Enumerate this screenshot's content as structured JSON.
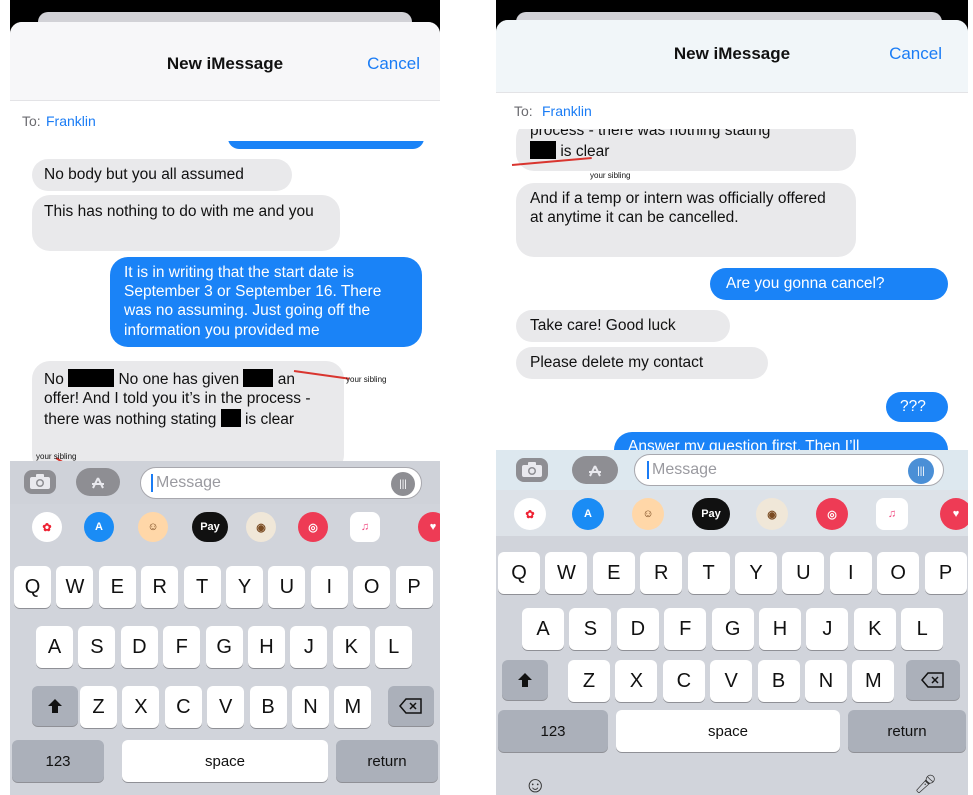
{
  "colors": {
    "accent": "#1a7cf5",
    "sent_bubble": "#1a83f7",
    "received_bubble": "#e9e9eb",
    "keyboard": "#d1d4db",
    "annotation": "#d9352f"
  },
  "left": {
    "nav": {
      "title": "New iMessage",
      "cancel": "Cancel"
    },
    "to": {
      "label": "To:",
      "name": "Franklin"
    },
    "messages": {
      "m1": "No body but you all assumed",
      "m2": "This has nothing to do with me and you",
      "m3": "It is in writing that the start date is September 3 or September 16. There was no assuming. Just going off the information you provided me",
      "m4a": "No",
      "m4b": "No one has given",
      "m4c": "an",
      "m4d": "offer! And I told you it’s in the process - there was nothing stating",
      "m4e": "is clear"
    },
    "notes": {
      "n1": "your sibling",
      "n2": "your sibling"
    },
    "input_placeholder": "Message"
  },
  "right": {
    "nav": {
      "title": "New iMessage",
      "cancel": "Cancel"
    },
    "to": {
      "label": "To:",
      "name": "Franklin"
    },
    "messages": {
      "m1a": "process - there was nothing stating",
      "m1b": "is clear",
      "m2": "And if a temp or intern was officially offered at anytime it can be cancelled.",
      "m3": "Are you gonna cancel?",
      "m4": "Take care! Good luck",
      "m5": "Please delete my contact",
      "m6": "???",
      "m7": "Answer my question first. Then I’ll"
    },
    "notes": {
      "n1": "your sibling"
    },
    "input_placeholder": "Message"
  },
  "app_strip": {
    "apple_pay": "Pay"
  },
  "keyboard": {
    "row1": [
      "Q",
      "W",
      "E",
      "R",
      "T",
      "Y",
      "U",
      "I",
      "O",
      "P"
    ],
    "row2": [
      "A",
      "S",
      "D",
      "F",
      "G",
      "H",
      "J",
      "K",
      "L"
    ],
    "row3": [
      "Z",
      "X",
      "C",
      "V",
      "B",
      "N",
      "M"
    ],
    "numbers": "123",
    "space": "space",
    "return": "return"
  },
  "icons": {
    "camera": "camera-icon",
    "appstore": "app-store-icon",
    "audio": "audio-waveform-icon",
    "shift": "shift-arrow-icon",
    "delete": "backspace-icon",
    "emoji": "emoji-icon",
    "mic": "microphone-icon"
  }
}
